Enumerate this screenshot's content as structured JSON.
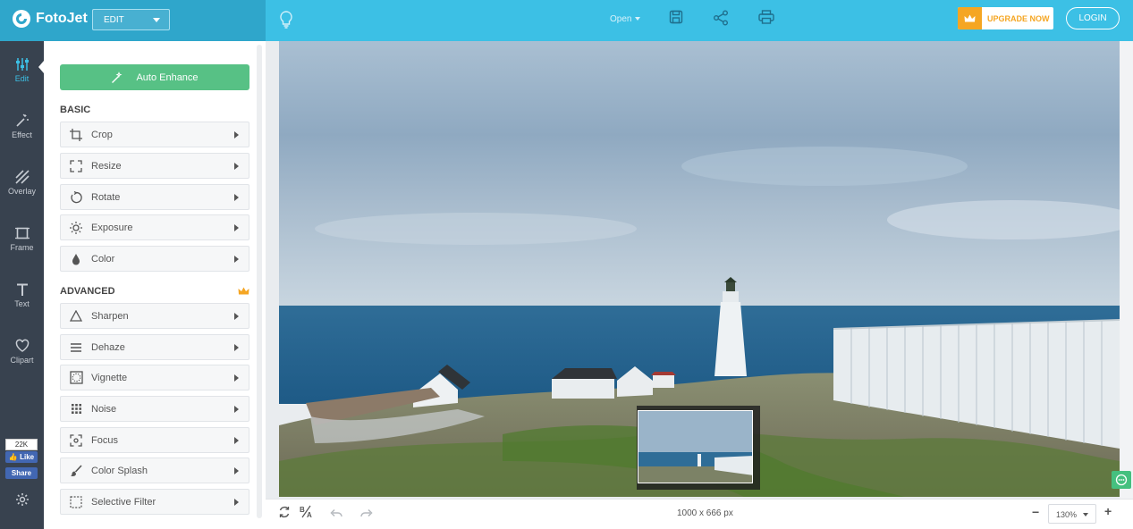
{
  "app": {
    "logo_text": "FotoJet",
    "mode": "EDIT"
  },
  "header": {
    "open_label": "Open",
    "upgrade_label": "UPGRADE NOW",
    "login_label": "LOGIN",
    "icons": [
      "lightbulb-icon",
      "save-icon",
      "share-icon",
      "print-icon",
      "crown-icon"
    ]
  },
  "sidebar": {
    "items": [
      {
        "label": "Edit",
        "icon": "sliders-icon",
        "active": true
      },
      {
        "label": "Effect",
        "icon": "magic-wand-icon"
      },
      {
        "label": "Overlay",
        "icon": "overlay-icon"
      },
      {
        "label": "Frame",
        "icon": "frame-icon"
      },
      {
        "label": "Text",
        "icon": "text-icon"
      },
      {
        "label": "Clipart",
        "icon": "heart-icon"
      }
    ],
    "fb_count": "22K",
    "fb_like": "Like",
    "fb_share": "Share",
    "settings_icon": "gear-icon"
  },
  "panel": {
    "auto_enhance": "Auto Enhance",
    "basic_title": "BASIC",
    "advanced_title": "ADVANCED",
    "basic_tools": [
      {
        "label": "Crop",
        "icon": "crop-icon"
      },
      {
        "label": "Resize",
        "icon": "resize-icon"
      },
      {
        "label": "Rotate",
        "icon": "rotate-icon"
      },
      {
        "label": "Exposure",
        "icon": "sun-icon"
      },
      {
        "label": "Color",
        "icon": "drop-icon"
      }
    ],
    "advanced_tools": [
      {
        "label": "Sharpen",
        "icon": "triangle-icon"
      },
      {
        "label": "Dehaze",
        "icon": "lines-icon"
      },
      {
        "label": "Vignette",
        "icon": "vignette-icon"
      },
      {
        "label": "Noise",
        "icon": "grid-dots-icon"
      },
      {
        "label": "Focus",
        "icon": "focus-icon"
      },
      {
        "label": "Color Splash",
        "icon": "brush-icon"
      },
      {
        "label": "Selective Filter",
        "icon": "dashed-square-icon"
      }
    ]
  },
  "canvas": {
    "dimensions": "1000 x 666 px",
    "zoom": "130%",
    "zoom_minus": "−",
    "zoom_plus": "+"
  },
  "colors": {
    "topbar": "#3cc0e5",
    "topbar_left": "#2fa6cb",
    "iconbar": "#38424f",
    "accent_green": "#57c185",
    "upgrade_orange": "#f5a623"
  }
}
